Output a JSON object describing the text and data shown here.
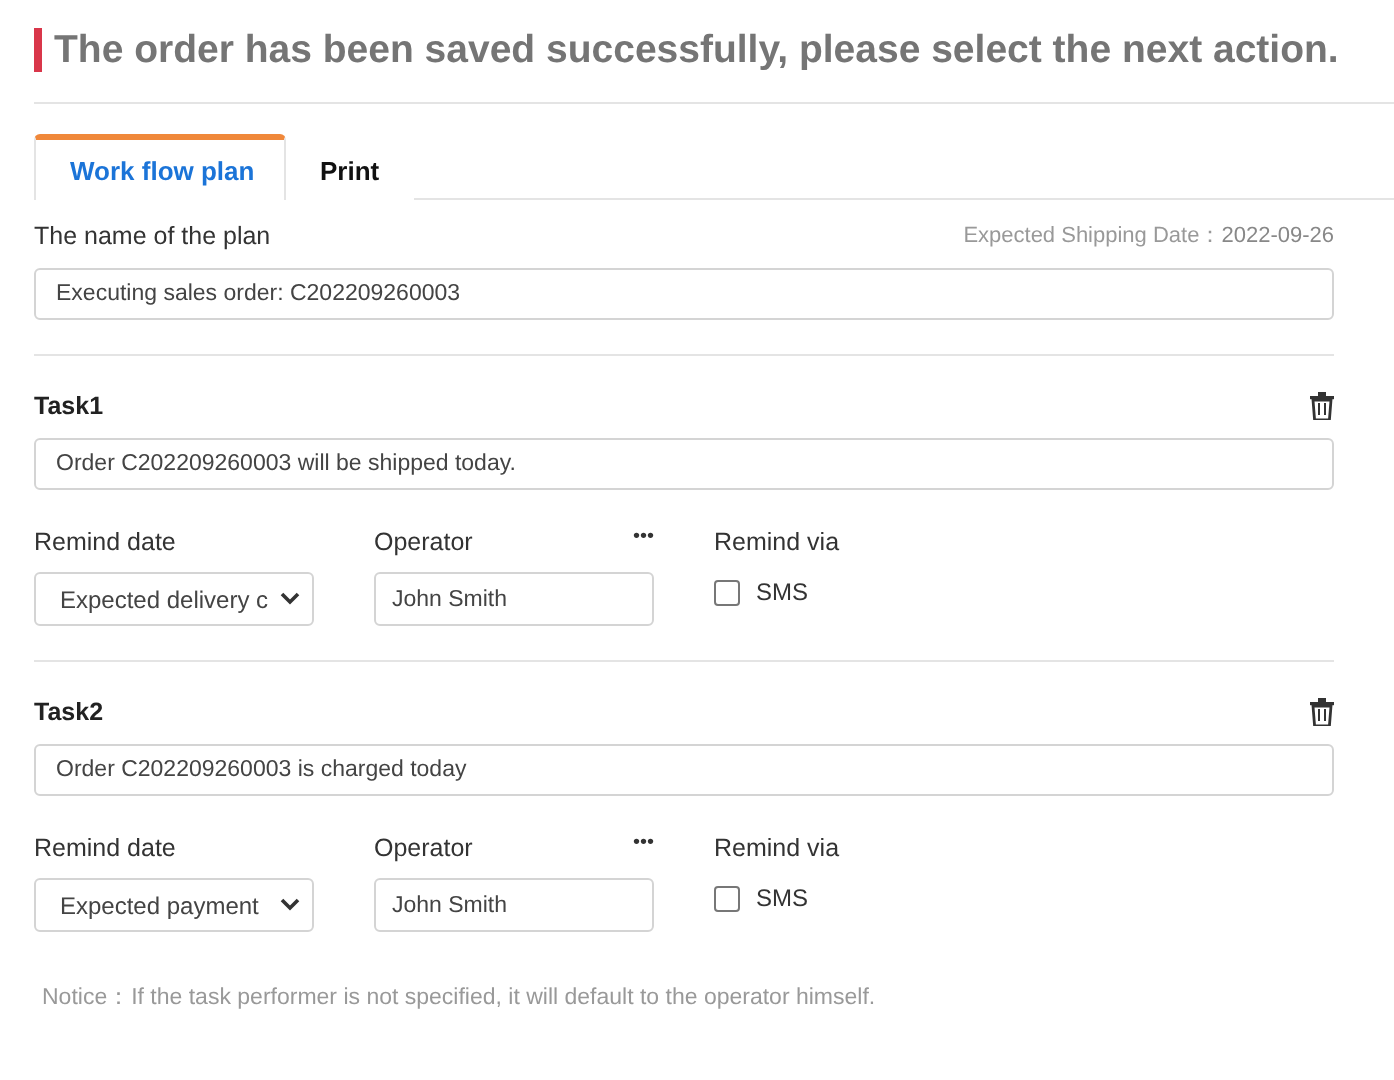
{
  "header": {
    "title": "The order has been saved successfully, please select the next action."
  },
  "tabs": [
    {
      "label": "Work flow plan",
      "selected": true
    },
    {
      "label": "Print",
      "selected": false
    }
  ],
  "plan": {
    "label": "The name of the plan",
    "shipping_label": "Expected Shipping Date：",
    "shipping_date": "2022-09-26",
    "value": "Executing sales order: C202209260003"
  },
  "tasks": [
    {
      "title": "Task1",
      "value": "Order C202209260003 will be shipped today.",
      "remind_date_label": "Remind date",
      "remind_date": "Expected delivery c",
      "operator_label": "Operator",
      "more": "•••",
      "operator": "John Smith",
      "remind_via_label": "Remind via",
      "sms": {
        "label": "SMS",
        "checked": false
      }
    },
    {
      "title": "Task2",
      "value": "Order C202209260003 is charged today",
      "remind_date_label": "Remind date",
      "remind_date": "Expected payment",
      "operator_label": "Operator",
      "more": "•••",
      "operator": "John Smith",
      "remind_via_label": "Remind via",
      "sms": {
        "label": "SMS",
        "checked": false
      }
    }
  ],
  "notice": "Notice：If the task performer is not specified, it will default to the operator himself."
}
